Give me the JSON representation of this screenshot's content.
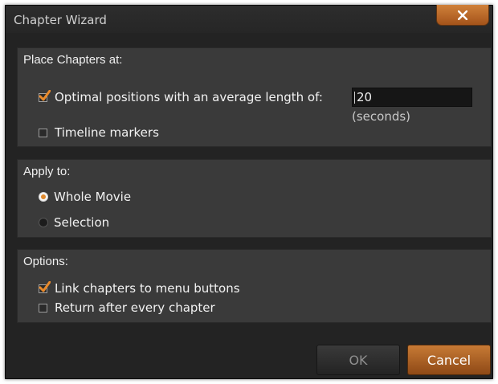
{
  "window": {
    "title": "Chapter Wizard"
  },
  "place_chapters": {
    "heading": "Place Chapters at:",
    "optimal": {
      "label": "Optimal positions with an average length of:",
      "checked": true
    },
    "length_value": "20",
    "length_unit": "(seconds)",
    "timeline": {
      "label": "Timeline markers",
      "checked": false
    }
  },
  "apply_to": {
    "heading": "Apply to:",
    "options": [
      {
        "label": "Whole Movie",
        "selected": true
      },
      {
        "label": "Selection",
        "selected": false
      }
    ]
  },
  "options": {
    "heading": "Options:",
    "link_chapters": {
      "label": "Link chapters to menu buttons",
      "checked": true
    },
    "return_after": {
      "label": "Return after every chapter",
      "checked": false
    }
  },
  "buttons": {
    "ok": "OK",
    "cancel": "Cancel"
  },
  "colors": {
    "accent": "#e08a2e",
    "background": "#232323",
    "panel": "#3a3a3a"
  }
}
